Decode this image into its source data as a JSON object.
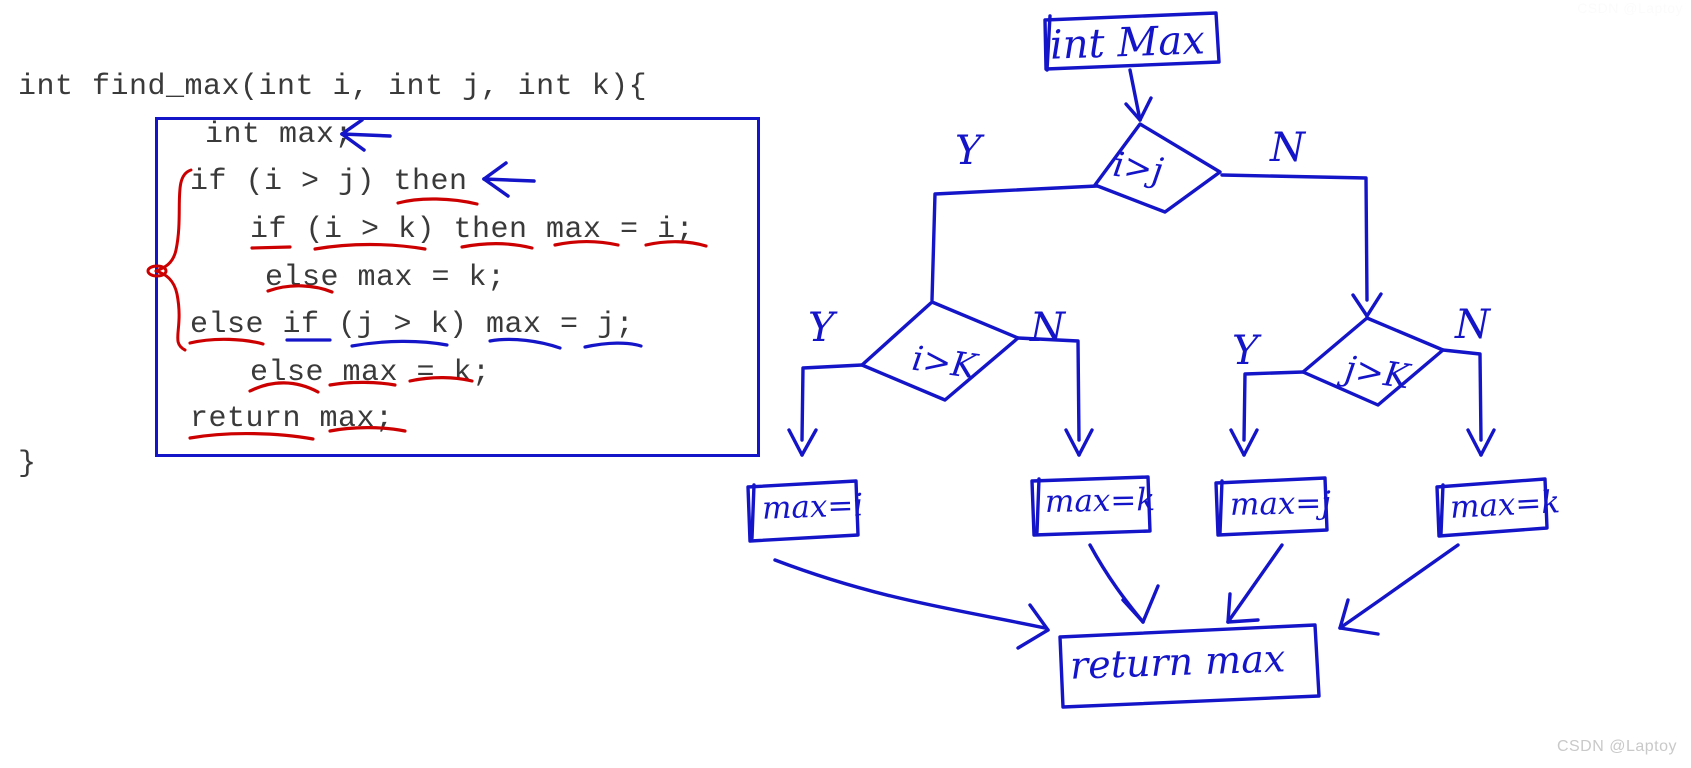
{
  "code": {
    "signature": "int find_max(int i, int j, int k){",
    "lines": [
      "int max;",
      "if (i > j) then",
      "if (i > k) then max = i;",
      "else max = k;",
      "else if (j > k) max = j;",
      "else max = k;",
      "return max;"
    ],
    "closing_brace": "}",
    "box_color": "#1414c8",
    "underline_red": "#cc0000",
    "underline_blue": "#1414c8",
    "arrow_color": "#1414c8",
    "brace_color": "#cc0000"
  },
  "flowchart": {
    "start_box": "int Max",
    "decisions": [
      {
        "id": "d1",
        "label": "i>j"
      },
      {
        "id": "d2",
        "label": "i>K"
      },
      {
        "id": "d3",
        "label": "j>K"
      }
    ],
    "branch_labels": {
      "d1_yes": "Y",
      "d1_no": "N",
      "d2_yes": "Y",
      "d2_no": "N",
      "d3_yes": "Y",
      "d3_no": "N"
    },
    "assign_boxes": [
      {
        "id": "a1",
        "label": "max=i"
      },
      {
        "id": "a2",
        "label": "max=k"
      },
      {
        "id": "a3",
        "label": "max=j"
      },
      {
        "id": "a4",
        "label": "max=k"
      }
    ],
    "end_box": "return  max",
    "ink_color": "#1414c8"
  },
  "watermarks": {
    "bottom_right": "CSDN @Laptoy",
    "top_right": "CSDN @Laptoy"
  }
}
